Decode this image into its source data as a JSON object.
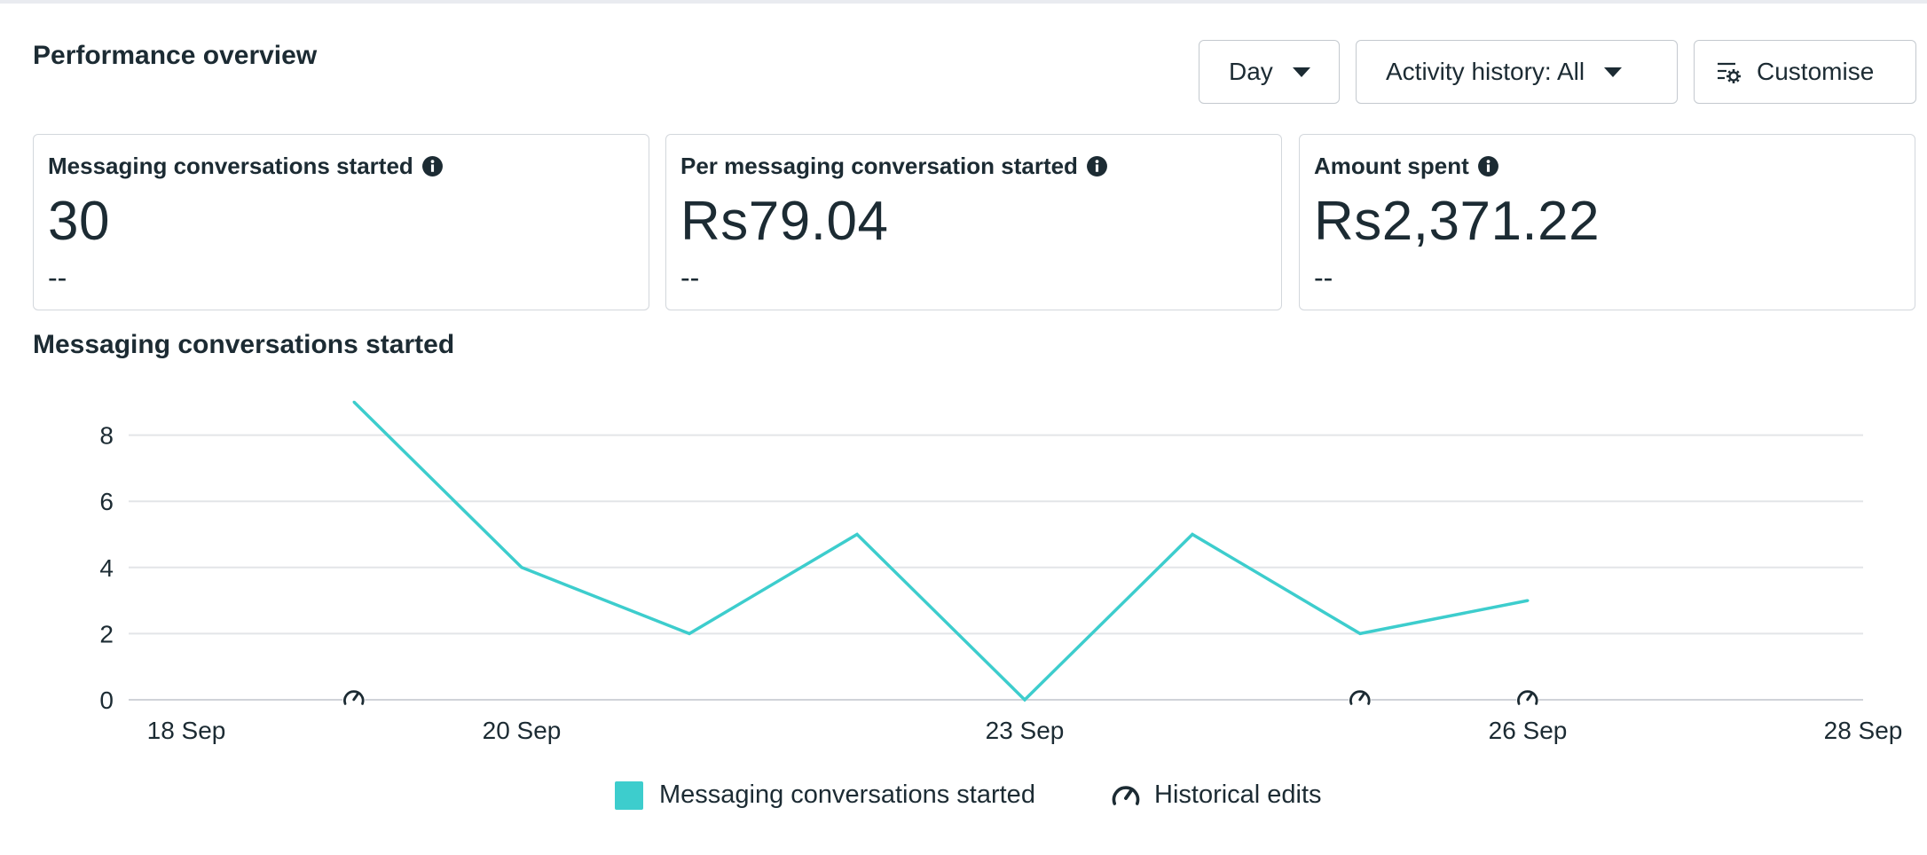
{
  "header": {
    "title": "Performance overview",
    "day_button": "Day",
    "activity_button": "Activity history: All",
    "customise_button": "Customise"
  },
  "cards": [
    {
      "label": "Messaging conversations started",
      "value": "30",
      "comparison": "--"
    },
    {
      "label": "Per messaging conversation started",
      "value": "Rs79.04",
      "comparison": "--"
    },
    {
      "label": "Amount spent",
      "value": "Rs2,371.22",
      "comparison": "--"
    }
  ],
  "icons": {
    "info": "info-icon",
    "dropdown": "caret-down-icon",
    "customise": "customise-settings-icon",
    "historical_edit": "historical-edit-gauge-icon"
  },
  "colors": {
    "series": "#3dcdcd",
    "text": "#1c2b33",
    "grid": "#e3e5e8",
    "border": "#d3d7dc"
  },
  "chart_data": {
    "type": "line",
    "title": "Messaging conversations started",
    "x": [
      "19 Sep",
      "20 Sep",
      "21 Sep",
      "22 Sep",
      "23 Sep",
      "24 Sep",
      "25 Sep",
      "26 Sep"
    ],
    "series": [
      {
        "name": "Messaging conversations started",
        "values": [
          9,
          4,
          2,
          5,
          0,
          5,
          2,
          3
        ]
      }
    ],
    "xlim": [
      "18 Sep",
      "28 Sep"
    ],
    "x_ticks": [
      "18 Sep",
      "20 Sep",
      "23 Sep",
      "26 Sep",
      "28 Sep"
    ],
    "y_ticks": [
      "0",
      "2",
      "4",
      "6",
      "8"
    ],
    "ylim": [
      0,
      9
    ],
    "historical_edits": [
      "19 Sep",
      "25 Sep",
      "26 Sep"
    ],
    "grid": true,
    "legend": [
      {
        "label": "Messaging conversations started",
        "marker": "swatch"
      },
      {
        "label": "Historical edits",
        "marker": "historical-edit-gauge-icon"
      }
    ],
    "legend_position": "bottom"
  }
}
